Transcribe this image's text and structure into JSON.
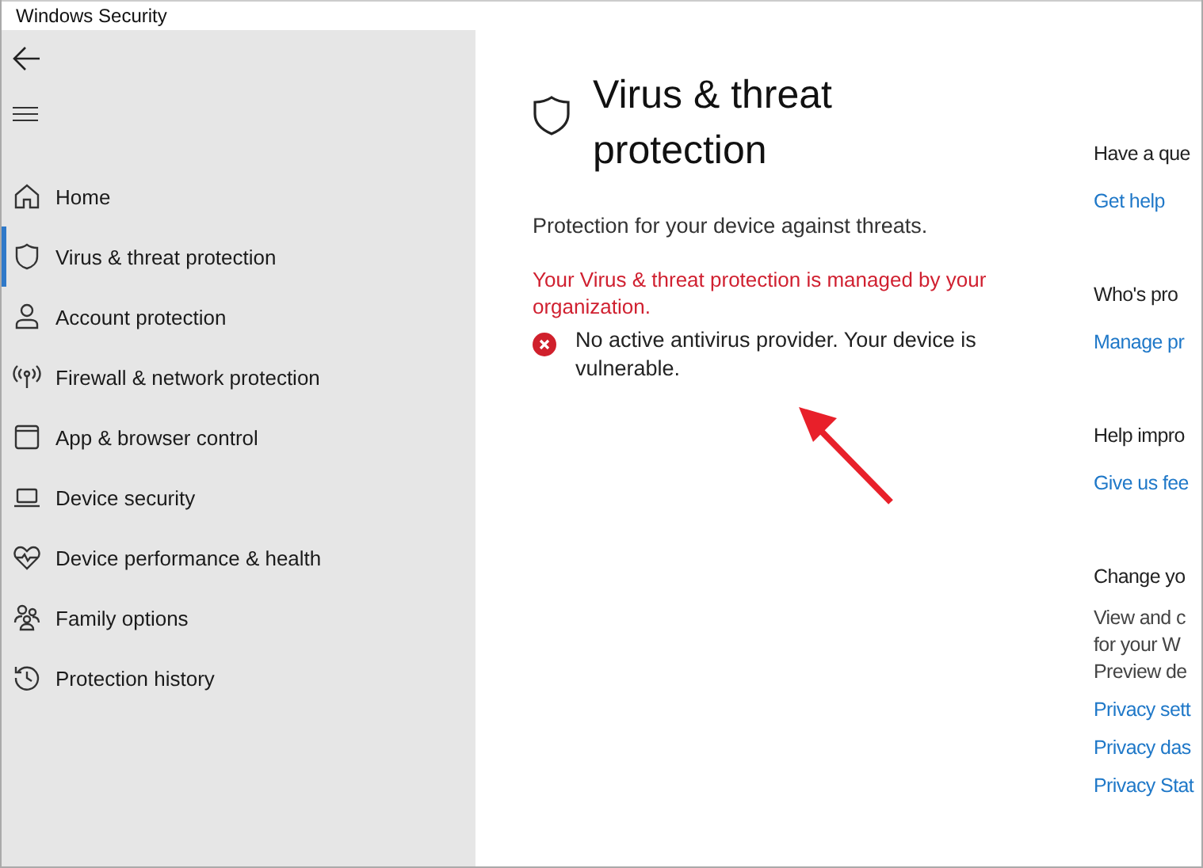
{
  "window": {
    "title": "Windows Security"
  },
  "sidebar": {
    "items": [
      {
        "label": "Home",
        "selected": false
      },
      {
        "label": "Virus & threat protection",
        "selected": true
      },
      {
        "label": "Account protection",
        "selected": false
      },
      {
        "label": "Firewall & network protection",
        "selected": false
      },
      {
        "label": "App & browser control",
        "selected": false
      },
      {
        "label": "Device security",
        "selected": false
      },
      {
        "label": "Device performance & health",
        "selected": false
      },
      {
        "label": "Family options",
        "selected": false
      },
      {
        "label": "Protection history",
        "selected": false
      }
    ]
  },
  "main": {
    "title": "Virus & threat protection",
    "subtitle": "Protection for your device against threats.",
    "managed_notice": "Your Virus & threat protection is managed by your organization.",
    "alert": "No active antivirus provider. Your device is vulnerable."
  },
  "side_panel": {
    "sections": [
      {
        "heading": "Have a que",
        "links": [
          "Get help"
        ]
      },
      {
        "heading": "Who's pro",
        "links": [
          "Manage pr"
        ]
      },
      {
        "heading": "Help impro",
        "links": [
          "Give us fee"
        ]
      },
      {
        "heading": "Change yo",
        "lines": [
          "View and c",
          "for your W",
          "Preview de"
        ],
        "links": [
          "Privacy sett",
          "Privacy das",
          "Privacy Stat"
        ]
      }
    ]
  }
}
